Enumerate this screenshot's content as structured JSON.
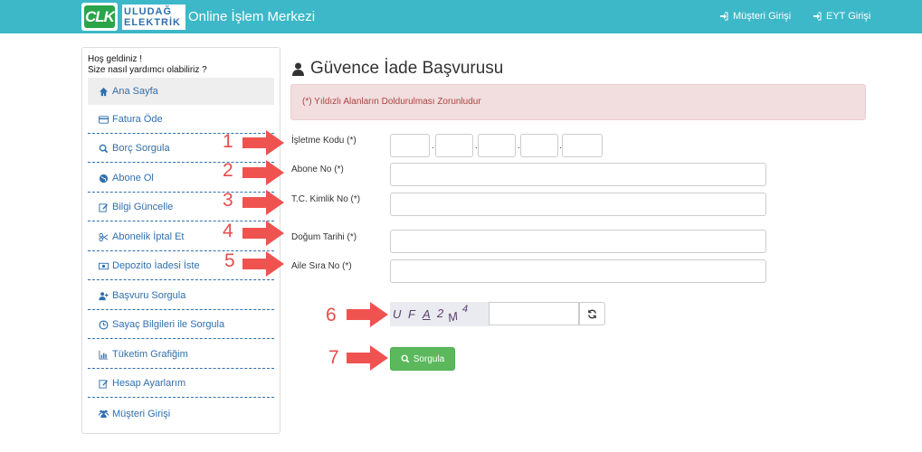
{
  "header": {
    "logo_mark": "CLK",
    "logo_line1": "ULUDAĞ",
    "logo_line2": "ELEKTRİK",
    "brand": "Online İşlem Merkezi",
    "customer_login": "Müşteri Girişi",
    "eyt_login": "EYT Girişi"
  },
  "sidebar": {
    "welcome_line1": "Hoş geldiniz !",
    "welcome_line2": "Size nasıl yardımcı olabiliriz ?",
    "items": [
      {
        "label": "Ana Sayfa",
        "icon": "home-icon"
      },
      {
        "label": "Fatura Öde",
        "icon": "credit-card-icon"
      },
      {
        "label": "Borç Sorgula",
        "icon": "search-icon"
      },
      {
        "label": "Abone Ol",
        "icon": "globe-icon"
      },
      {
        "label": "Bilgi Güncelle",
        "icon": "edit-icon"
      },
      {
        "label": "Abonelik İptal Et",
        "icon": "scissors-icon"
      },
      {
        "label": "Depozito İadesi İste",
        "icon": "money-icon"
      },
      {
        "label": "Başvuru Sorgula",
        "icon": "user-plus-icon"
      },
      {
        "label": "Sayaç Bilgileri ile Sorgula",
        "icon": "clock-icon"
      },
      {
        "label": "Tüketim Grafiğim",
        "icon": "bar-chart-icon"
      },
      {
        "label": "Hesap Ayarlarım",
        "icon": "edit-icon"
      },
      {
        "label": "Müşteri Girişi",
        "icon": "users-icon"
      }
    ]
  },
  "main": {
    "title": "Güvence İade Başvurusu",
    "alert": "(*) Yıldızlı Alanların Doldurulması Zorunludur",
    "fields": {
      "isletme_kodu": "İşletme Kodu (*)",
      "abone_no": "Abone No (*)",
      "tc_kimlik": "T.C. Kimlik No (*)",
      "dogum_tarihi": "Doğum Tarihi (*)",
      "aile_sira": "Aile Sıra No (*)"
    },
    "dot": ".",
    "captcha_chars": [
      "U",
      "F",
      "A",
      "2",
      "M",
      "4"
    ],
    "submit": "Sorgula"
  },
  "annotations": [
    "1",
    "2",
    "3",
    "4",
    "5",
    "6",
    "7"
  ],
  "colors": {
    "navbar": "#3db8c9",
    "alert_bg": "#f2dede",
    "button": "#5cb85c",
    "annotation": "#e84c4c"
  }
}
